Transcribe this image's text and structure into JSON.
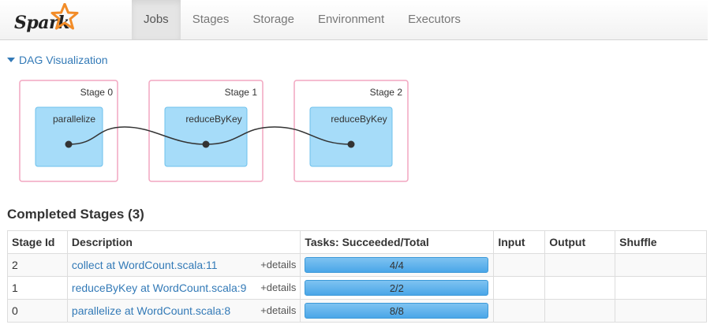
{
  "brand": {
    "name": "Spark",
    "star_color": "#f28c28"
  },
  "nav": {
    "items": [
      "Jobs",
      "Stages",
      "Storage",
      "Environment",
      "Executors"
    ],
    "active": "Jobs"
  },
  "dag": {
    "toggle_label": "DAG Visualization",
    "stages": [
      {
        "label": "Stage 0",
        "op": "parallelize"
      },
      {
        "label": "Stage 1",
        "op": "reduceByKey"
      },
      {
        "label": "Stage 2",
        "op": "reduceByKey"
      }
    ],
    "colors": {
      "stage_border": "#f2a6c0",
      "op_fill": "#a6dcf9",
      "op_border": "#6ec1ec",
      "edge": "#333333"
    }
  },
  "completed_stages": {
    "title": "Completed Stages (3)",
    "columns": [
      "Stage Id",
      "Description",
      "Tasks: Succeeded/Total",
      "Input",
      "Output",
      "Shuffle"
    ],
    "rows": [
      {
        "id": "2",
        "description": "collect at WordCount.scala:11",
        "details": "+details",
        "tasks": "4/4",
        "progress": 1.0,
        "input": "",
        "output": "",
        "shuffle": ""
      },
      {
        "id": "1",
        "description": "reduceByKey at WordCount.scala:9",
        "details": "+details",
        "tasks": "2/2",
        "progress": 1.0,
        "input": "",
        "output": "",
        "shuffle": ""
      },
      {
        "id": "0",
        "description": "parallelize at WordCount.scala:8",
        "details": "+details",
        "tasks": "8/8",
        "progress": 1.0,
        "input": "",
        "output": "",
        "shuffle": ""
      }
    ]
  }
}
